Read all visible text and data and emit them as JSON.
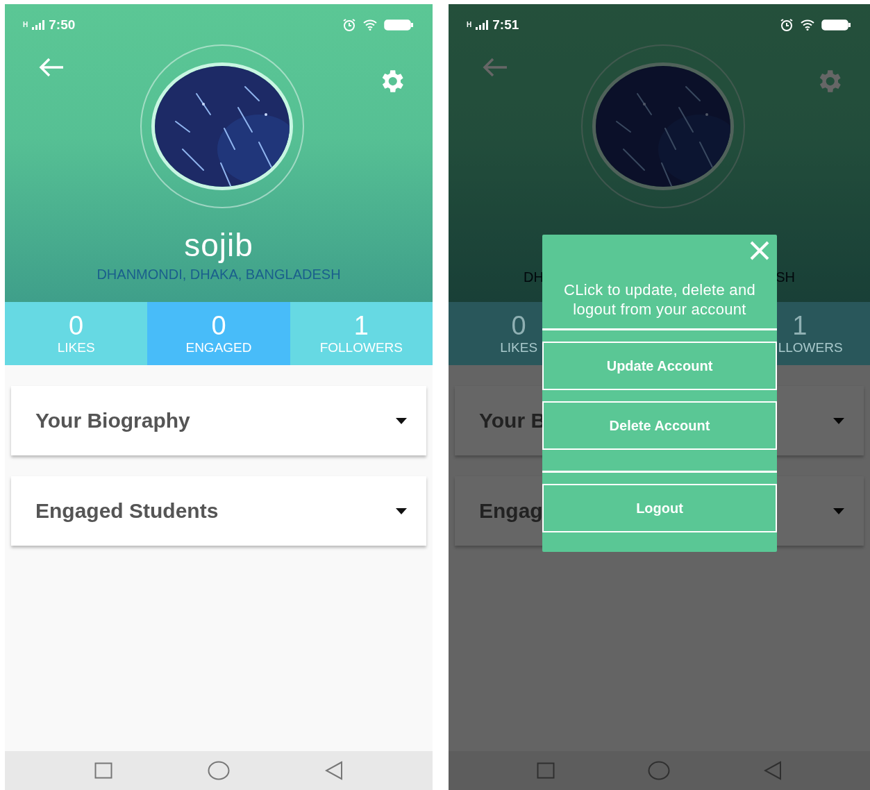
{
  "screens": [
    {
      "status_bar": {
        "network": "H",
        "time": "7:50"
      },
      "header": {
        "name": "sojib",
        "location": "DHANMONDI, DHAKA, BANGLADESH"
      },
      "stats": [
        {
          "value": "0",
          "label": "LIKES",
          "selected": false
        },
        {
          "value": "0",
          "label": "ENGAGED",
          "selected": true
        },
        {
          "value": "1",
          "label": "FOLLOWERS",
          "selected": false
        }
      ],
      "sections": [
        {
          "title": "Your Biography"
        },
        {
          "title": "Engaged Students"
        }
      ]
    },
    {
      "status_bar": {
        "network": "H",
        "time": "7:51"
      },
      "header": {
        "location_fragments": [
          "DH",
          "SH"
        ]
      },
      "stats": [
        {
          "value": "0",
          "label": "LIKES",
          "selected": false
        },
        {
          "value": "1",
          "label": "LLOWERS",
          "selected": false
        }
      ],
      "sections": [
        {
          "title": "Your B"
        },
        {
          "title": "Engag"
        }
      ],
      "dialog": {
        "message": "CLick to update, delete and logout from your account",
        "buttons": [
          "Update Account",
          "Delete Account",
          "Logout"
        ]
      }
    }
  ]
}
